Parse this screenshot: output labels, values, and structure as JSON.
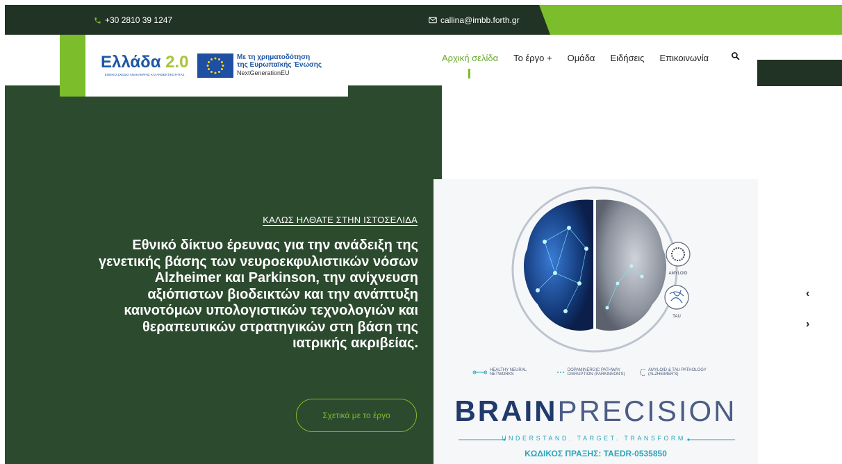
{
  "topbar": {
    "phone": "+30 2810 39 1247",
    "email": "callina@imbb.forth.gr",
    "colors": {
      "dark": "#213324",
      "accent": "#7bbd2a"
    }
  },
  "logo": {
    "word": "Ελλάδα",
    "version": "2.0",
    "subtitle": "ΕΘΝΙΚΟ ΣΧΕΔΙΟ ΑΝΑΚΑΜΨΗΣ ΚΑΙ ΑΝΘΕΚΤΙΚΟΤΗΤΑΣ",
    "eu_line1": "Με τη χρηματοδότηση",
    "eu_line2": "της Ευρωπαϊκής Ένωσης",
    "eu_program": "NextGenerationEU"
  },
  "nav": {
    "items": [
      {
        "label": "Αρχική σελίδα",
        "active": true
      },
      {
        "label": "Το έργο +"
      },
      {
        "label": "Ομάδα"
      },
      {
        "label": "Ειδήσεις"
      },
      {
        "label": "Επικοινωνία"
      }
    ],
    "search_icon": "search-icon"
  },
  "hero": {
    "welcome": "ΚΑΛΩΣ ΗΛΘΑΤΕ ΣΤΗΝ ΙΣΤΟΣΕΛΙΔΑ",
    "headline_part1": "Εθνικό δίκτυο έρευνας για την ανάδειξη της γενετικής βάσης των νευροεκφυλιστικών νόσων ",
    "headline_alz": "Alzheimer",
    "headline_and": " και ",
    "headline_park": "Parkinson",
    "headline_part2": ", την ανίχνευση αξιόπιστων βιοδεικτών και την ανάπτυξη καινοτόμων υπολογιστικών τεχνολογιών και θεραπευτικών στρατηγικών στη βάση της ιατρικής ακριβείας.",
    "cta": "Σχετικά με το έργο",
    "background": "#2c4a2e"
  },
  "poster": {
    "amyloid": "AMYLOID",
    "tau": "TAU",
    "legend1": "HEALTHY NEURAL NETWORKS",
    "legend2": "DOPAMINERGIC PATHWAY DISRUPTION (PARKINSON'S)",
    "legend3": "AMYLOID & TAU PATHOLOGY (ALZHEIMER'S)",
    "brand_bold": "BRAIN",
    "brand_light": "PRECISION",
    "tagline": "UNDERSTAND. TARGET. TRANSFORM.",
    "code": "ΚΩΔΙΚΟΣ ΠΡΑΞΗΣ: TAEDR-0535850"
  },
  "slider": {
    "prev_icon": "chevron-left-icon",
    "next_icon": "chevron-right-icon"
  }
}
